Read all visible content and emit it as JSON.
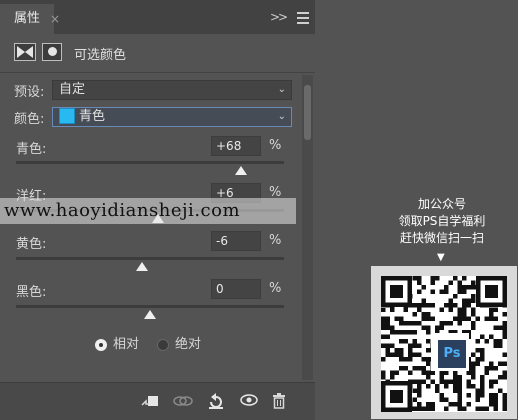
{
  "panel": {
    "tab_label": "属性",
    "tab_close": "×",
    "collapse_glyph": ">>",
    "header_title": "可选颜色"
  },
  "preset": {
    "label": "预设:",
    "value": "自定"
  },
  "color": {
    "label": "颜色:",
    "value": "青色",
    "swatch_color": "#2ab8f0"
  },
  "sliders": [
    {
      "label": "青色:",
      "value": "+68",
      "unit": "%",
      "position_fraction": 0.84
    },
    {
      "label": "洋红:",
      "value": "+6",
      "unit": "%",
      "position_fraction": 0.53
    },
    {
      "label": "黄色:",
      "value": "-6",
      "unit": "%",
      "position_fraction": 0.47
    },
    {
      "label": "黑色:",
      "value": "0",
      "unit": "%",
      "position_fraction": 0.5
    }
  ],
  "mode": {
    "relative": "相对",
    "absolute": "绝对",
    "selected": "relative"
  },
  "bottom_icons": [
    "clip-to-layer-icon",
    "view-previous-icon",
    "reset-icon",
    "visibility-icon",
    "delete-icon"
  ],
  "watermark": "www.haoyidiansheji.com",
  "promo": {
    "line1": "加公众号",
    "line2": "领取PS自学福利",
    "line3": "赶快微信扫一扫",
    "arrow": "▼",
    "logo_text": "Ps"
  }
}
